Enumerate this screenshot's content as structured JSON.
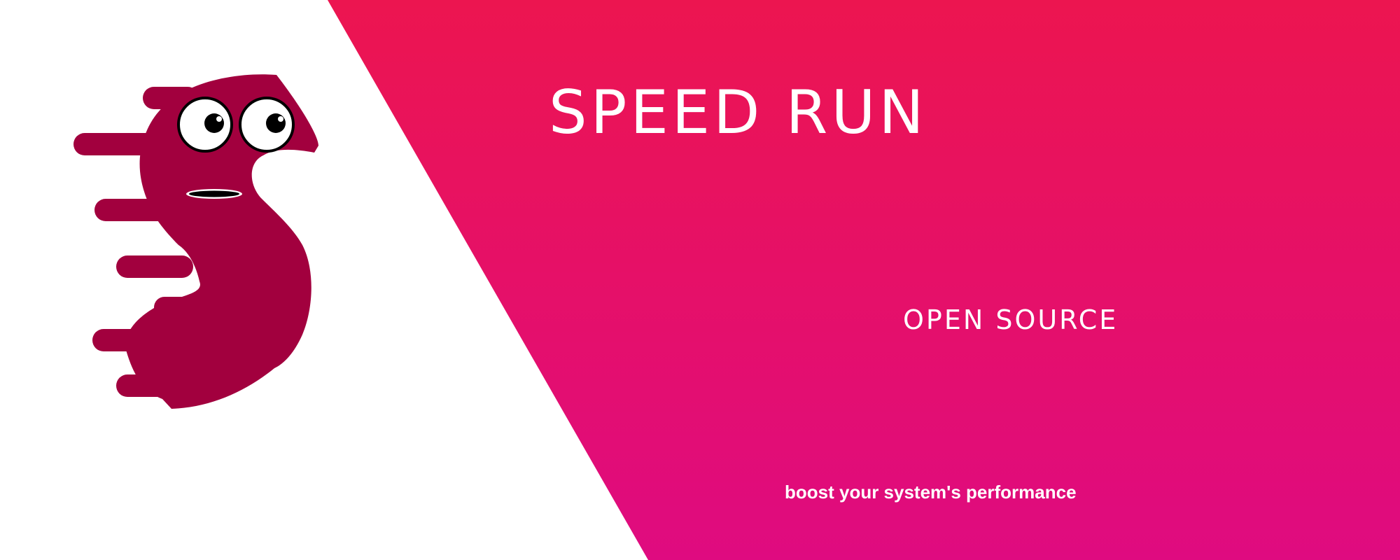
{
  "banner": {
    "title": "SPEED RUN",
    "subtitle": "OPEN SOURCE",
    "tagline": "boost your system's performance"
  },
  "colors": {
    "gradient_top": "#ec1550",
    "gradient_bottom": "#df0b80",
    "mascot_body": "#a2003e",
    "white": "#ffffff"
  },
  "mascot": {
    "icon": "speed-s-mascot-icon"
  }
}
